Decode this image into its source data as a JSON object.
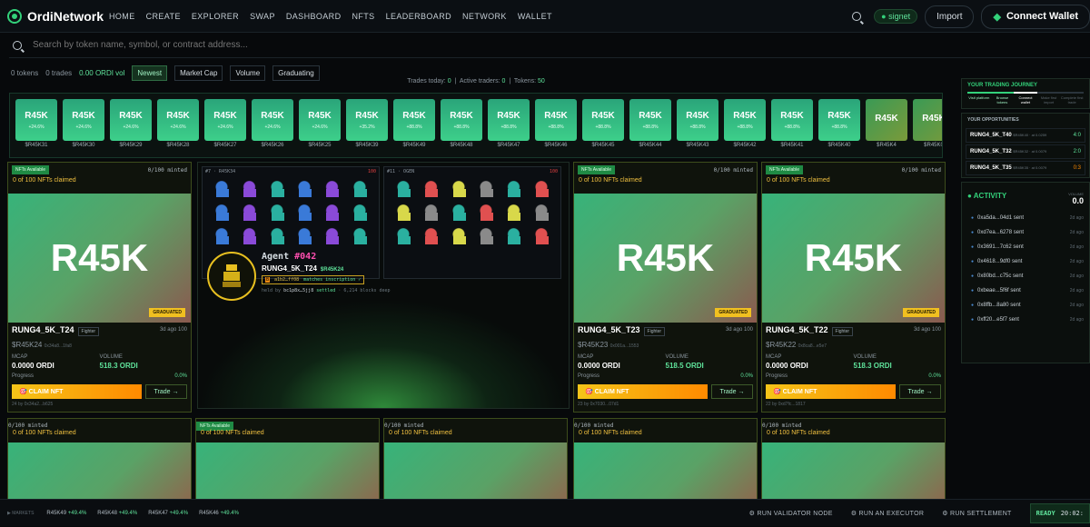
{
  "app": {
    "name": "OrdiNetwork"
  },
  "nav": [
    "HOME",
    "CREATE",
    "EXPLORER",
    "SWAP",
    "DASHBOARD",
    "NFTS",
    "LEADERBOARD",
    "NETWORK",
    "WALLET"
  ],
  "header": {
    "network": "signet",
    "import_label": "Import",
    "wallet_label": "Connect Wallet"
  },
  "search": {
    "placeholder": "Search by token name, symbol, or contract address..."
  },
  "filters": {
    "tokens": "0 tokens",
    "trades": "0 trades",
    "vol": "0.00 ORDI vol",
    "tabs": [
      "Newest",
      "Market Cap",
      "Volume",
      "Graduating"
    ]
  },
  "stats": {
    "trades_today_label": "Trades today:",
    "trades_today": "0",
    "active_label": "Active traders:",
    "active": "0",
    "tokens_label": "Tokens:",
    "tokens": "50"
  },
  "tape": [
    {
      "t": "R45K",
      "c": "+24.6%",
      "n": "$R45K31"
    },
    {
      "t": "R45K",
      "c": "+24.6%",
      "n": "$R45K30"
    },
    {
      "t": "R45K",
      "c": "+24.6%",
      "n": "$R45K29"
    },
    {
      "t": "R45K",
      "c": "+24.6%",
      "n": "$R45K28"
    },
    {
      "t": "R45K",
      "c": "+24.6%",
      "n": "$R45K27"
    },
    {
      "t": "R45K",
      "c": "+24.6%",
      "n": "$R45K26"
    },
    {
      "t": "R45K",
      "c": "+24.6%",
      "n": "$R45K25"
    },
    {
      "t": "R45K",
      "c": "+35.2%",
      "n": "$R45K39"
    },
    {
      "t": "R45K",
      "c": "+88.8%",
      "n": "$R45K49"
    },
    {
      "t": "R45K",
      "c": "+88.8%",
      "n": "$R45K48"
    },
    {
      "t": "R45K",
      "c": "+88.8%",
      "n": "$R45K47"
    },
    {
      "t": "R45K",
      "c": "+88.8%",
      "n": "$R45K46"
    },
    {
      "t": "R45K",
      "c": "+88.8%",
      "n": "$R45K45"
    },
    {
      "t": "R45K",
      "c": "+88.8%",
      "n": "$R45K44"
    },
    {
      "t": "R45K",
      "c": "+88.8%",
      "n": "$R45K43"
    },
    {
      "t": "R45K",
      "c": "+88.8%",
      "n": "$R45K42"
    },
    {
      "t": "R45K",
      "c": "+88.8%",
      "n": "$R45K41"
    },
    {
      "t": "R45K",
      "c": "+88.8%",
      "n": "$R45K40"
    },
    {
      "t": "R45K",
      "c": "",
      "n": "$R45K4"
    },
    {
      "t": "R45K",
      "c": "",
      "n": "$R45K0"
    }
  ],
  "cards": [
    {
      "avail": "NFTs Available",
      "minted": "0/100 minted",
      "claimed": "0 of 100 NFTs claimed",
      "art": "R45K",
      "badge": "GRADUATED",
      "name": "RUNG4_5K_T24",
      "type": "Fighter",
      "age": "3d ago 100",
      "sym": "$R45K24",
      "addr": "0x34a8...1fa8",
      "mcap_label": "MCAP",
      "mcap": "0.0000 ORDI",
      "vol_label": "VOLUME",
      "vol": "518.3 ORDI",
      "prog_label": "Progress",
      "prog": "0.0%",
      "claim": "CLAIM NFT",
      "trade": "Trade →",
      "by": "24 by 0x34a2...b625"
    },
    {
      "avail": "NFTs Available",
      "minted": "0/100 minted",
      "claimed": "0 of 100 NFTs claimed",
      "art": "R45K",
      "badge": "GRADUATED",
      "name": "RUNG4_5K_T23",
      "type": "Fighter",
      "age": "3d ago 100",
      "sym": "$R45K23",
      "addr": "0x001a...1553",
      "mcap_label": "MCAP",
      "mcap": "0.0000 ORDI",
      "vol_label": "VOLUME",
      "vol": "518.5 ORDI",
      "prog_label": "Progress",
      "prog": "0.0%",
      "claim": "CLAIM NFT",
      "trade": "Trade →",
      "by": "23 by 0x7030...07d1"
    },
    {
      "avail": "NFTs Available",
      "minted": "0/100 minted",
      "claimed": "0 of 100 NFTs claimed",
      "art": "R45K",
      "badge": "GRADUATED",
      "name": "RUNG4_5K_T22",
      "type": "Fighter",
      "age": "3d ago 100",
      "sym": "$R45K22",
      "addr": "0x8ca8...e5e7",
      "mcap_label": "MCAP",
      "mcap": "0.0000 ORDI",
      "vol_label": "VOLUME",
      "vol": "518.3 ORDI",
      "prog_label": "Progress",
      "prog": "0.0%",
      "claim": "CLAIM NFT",
      "trade": "Trade →",
      "by": "22 by 0xd7fc...1817"
    }
  ],
  "gallery": {
    "left_title": "#7 · R45K34",
    "left_num": "100",
    "right_title": "#11 · OGEN",
    "right_num": "100",
    "agent_label": "Agent",
    "agent_num": "#042",
    "agent_name": "RUNG4_5K_T24",
    "agent_sym": "$R45K24",
    "inscr_hash": "a1b2…ff08",
    "inscr_status": "matches inscription ✓",
    "held_label": "held by",
    "held_addr": "bc1p8x…5jj8",
    "held_state": "settled",
    "held_depth": "· 6,214 blocks deep"
  },
  "bottom_cards": [
    {
      "minted": "0/100 minted",
      "claimed": "0 of 100 NFTs claimed"
    },
    {
      "avail": "NFTs Available",
      "claimed": "0 of 100 NFTs claimed"
    },
    {
      "minted": "0/100 minted",
      "claimed": "0 of 100 NFTs claimed"
    },
    {
      "minted": "0/100 minted",
      "claimed": "0 of 100 NFTs claimed"
    },
    {
      "minted": "0/100 minted",
      "claimed": "0 of 100 NFTs claimed"
    }
  ],
  "journey": {
    "title": "YOUR TRADING JOURNEY",
    "steps": [
      "Visit platform",
      "Browse tokens",
      "Connect wallet",
      "Make first import",
      "Complete first trade"
    ]
  },
  "opps": {
    "title": "YOUR OPPORTUNITIES",
    "items": [
      {
        "name": "RUNG4_5K_T40",
        "sym": "$R45K40 · at 0.0259",
        "r": "4:0"
      },
      {
        "name": "RUNG4_5K_T32",
        "sym": "$R45K32 · at 0.0079",
        "r": "2:0"
      },
      {
        "name": "RUNG4_5K_T35",
        "sym": "$R45K35 · at 0.0079",
        "r": "0:3"
      }
    ]
  },
  "activity": {
    "title": "ACTIVITY",
    "vol_label": "VOLUME",
    "vol": "0.0",
    "items": [
      {
        "a": "0xa5da...04d1 sent",
        "t": "2d ago"
      },
      {
        "a": "0xd7ea...6278 sent",
        "t": "2d ago"
      },
      {
        "a": "0x3691...7c62 sent",
        "t": "2d ago"
      },
      {
        "a": "0x4618...9df0 sent",
        "t": "2d ago"
      },
      {
        "a": "0x80bd...c75c sent",
        "t": "2d ago"
      },
      {
        "a": "0xbeae...5f6f sent",
        "t": "2d ago"
      },
      {
        "a": "0x8ffb...8a80 sent",
        "t": "2d ago"
      },
      {
        "a": "0xff20...e5f7 sent",
        "t": "2d ago"
      }
    ]
  },
  "bottombar": {
    "marker": "▶ MARKETS",
    "ticks": [
      {
        "s": "R45K49",
        "c": "+49.4%"
      },
      {
        "s": "R45K48",
        "c": "+49.4%"
      },
      {
        "s": "R45K47",
        "c": "+49.4%"
      },
      {
        "s": "R45K46",
        "c": "+49.4%"
      }
    ],
    "validator": "RUN VALIDATOR NODE",
    "executor": "RUN AN EXECUTOR",
    "settle": "RUN SETTLEMENT",
    "ready": "READY",
    "time": "20:02:"
  },
  "colors": {
    "accent": "#33d17a",
    "gold": "#f5c518",
    "bg": "#07090b"
  }
}
